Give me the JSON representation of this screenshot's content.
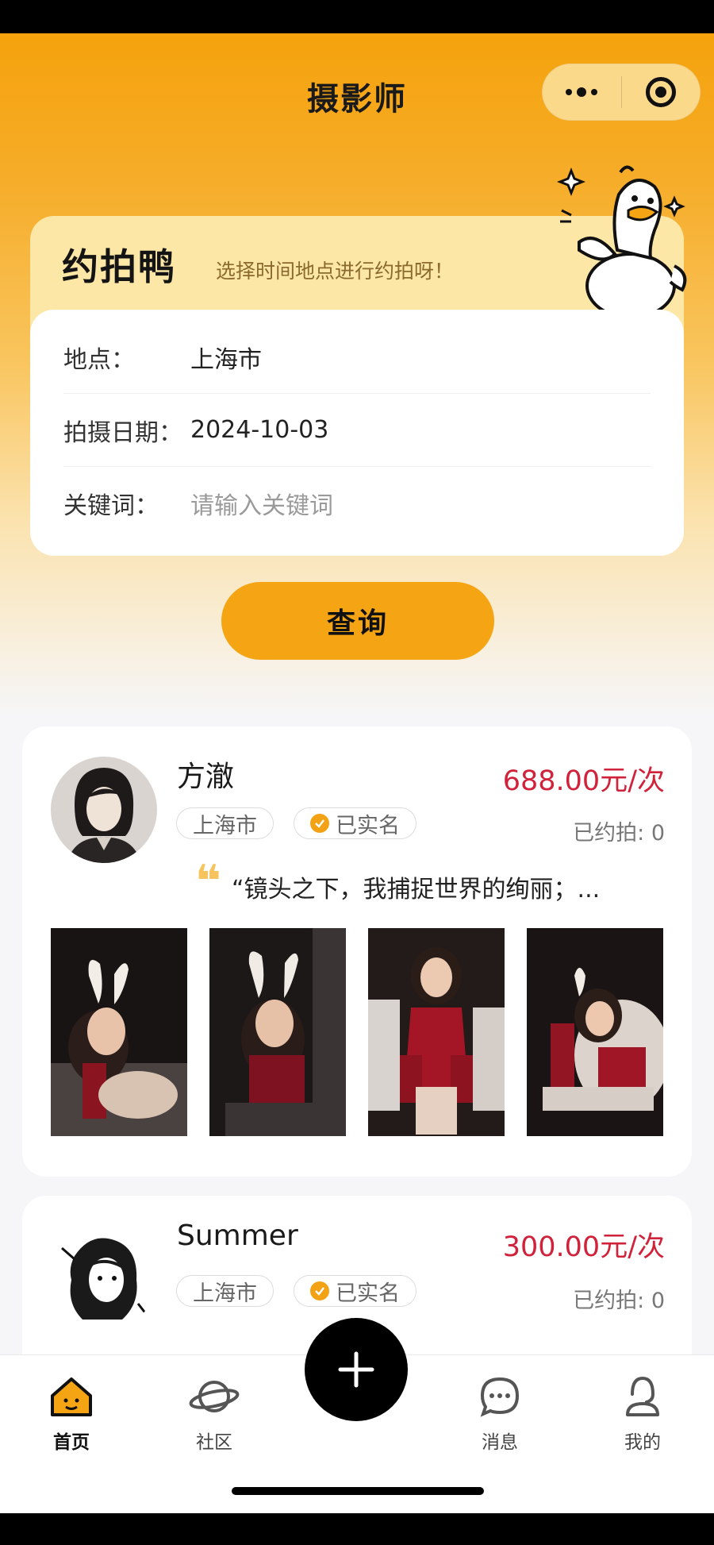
{
  "app": {
    "title": "摄影师"
  },
  "booking": {
    "brand": "约拍鸭",
    "slogan": "选择时间地点进行约拍呀！",
    "fields": [
      {
        "label": "地点：",
        "value": "上海市"
      },
      {
        "label": "拍摄日期：",
        "value": "2024-10-03"
      },
      {
        "label": "关键词：",
        "placeholder": "请输入关键词"
      }
    ],
    "query_label": "查询"
  },
  "photographers": [
    {
      "name": "方澈",
      "price": "688.00元/次",
      "city": "上海市",
      "verified": "已实名",
      "booked": "已约拍: 0",
      "quote": "“镜头之下，我捕捉世界的绚丽；..."
    },
    {
      "name": "Summer",
      "price": "300.00元/次",
      "city": "上海市",
      "verified": "已实名",
      "booked": "已约拍: 0"
    }
  ],
  "tabbar": {
    "items": [
      {
        "label": "首页",
        "icon": "home-icon",
        "active": true
      },
      {
        "label": "社区",
        "icon": "planet-icon"
      },
      {
        "label": "消息",
        "icon": "chat-bubble-icon"
      },
      {
        "label": "我的",
        "icon": "user-icon"
      }
    ],
    "add_icon": "plus-icon"
  },
  "colors": {
    "accent": "#f5a514",
    "price": "#d0223a",
    "brand_bg": "#fde7a6"
  }
}
